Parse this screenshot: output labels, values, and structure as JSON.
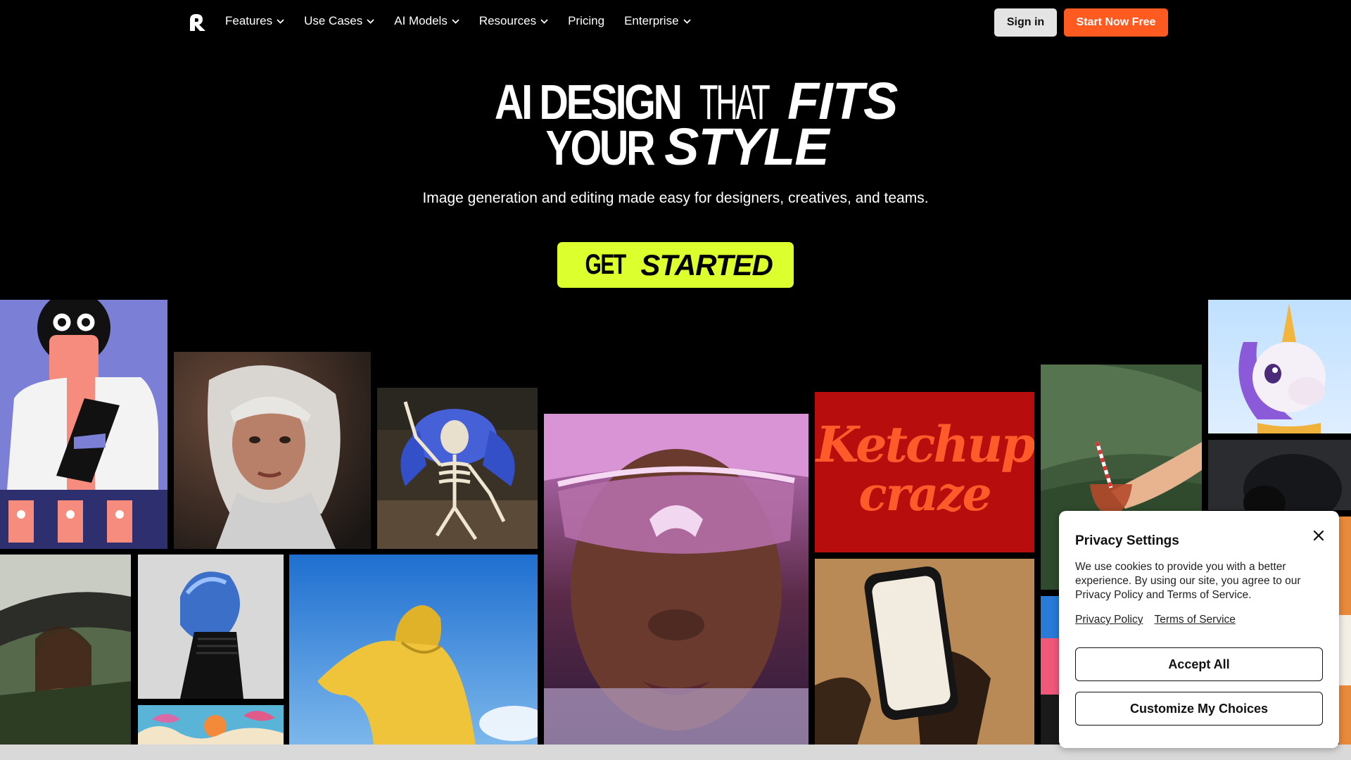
{
  "nav": {
    "logo_icon": "runway-style-r-logo",
    "items": [
      {
        "label": "Features",
        "has_dropdown": true
      },
      {
        "label": "Use Cases",
        "has_dropdown": true
      },
      {
        "label": "AI Models",
        "has_dropdown": true
      },
      {
        "label": "Resources",
        "has_dropdown": true
      },
      {
        "label": "Pricing",
        "has_dropdown": false
      },
      {
        "label": "Enterprise",
        "has_dropdown": true
      }
    ],
    "signin_label": "Sign in",
    "start_label": "Start Now Free"
  },
  "hero": {
    "line1": {
      "a": "AI DESIGN",
      "b": "THAT",
      "c": "FITS"
    },
    "line2": {
      "a": "YOUR",
      "b": "STYLE"
    },
    "subtitle": "Image generation and editing made easy for designers, creatives, and teams.",
    "cta": {
      "a": "GET",
      "b": "STARTED"
    }
  },
  "gallery": {
    "ketchup_text_1": "Ketchup",
    "ketchup_text_2": "craze"
  },
  "cookie": {
    "title": "Privacy Settings",
    "body": "We use cookies to provide you with a better experience. By using our site, you agree to our Privacy Policy and Terms of Service.",
    "link_privacy": "Privacy Policy",
    "link_terms": "Terms of Service",
    "accept_label": "Accept All",
    "customize_label": "Customize My Choices"
  },
  "colors": {
    "accent_orange": "#ff5a1f",
    "cta_lime": "#dcff2e",
    "background": "#000000"
  }
}
